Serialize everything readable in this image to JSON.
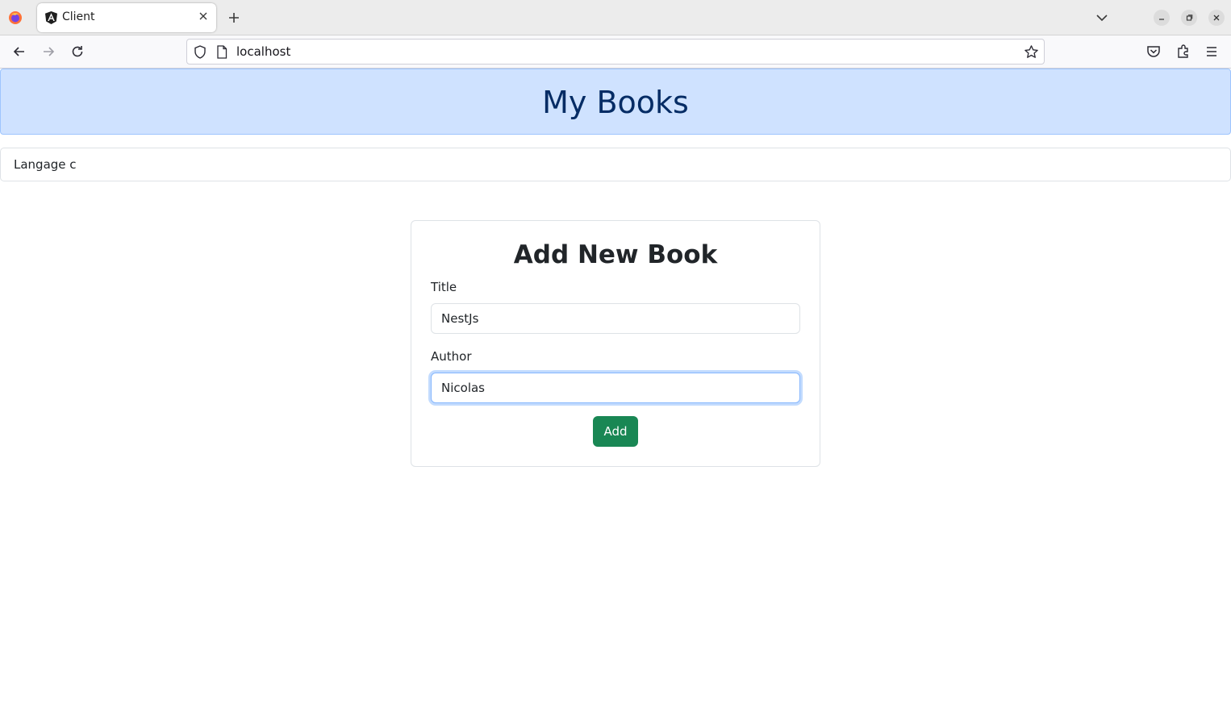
{
  "browser": {
    "tab": {
      "title": "Client"
    },
    "url": "localhost",
    "icons": [
      "firefox-logo-icon",
      "angular-icon",
      "close-icon",
      "plus-icon",
      "chevron-down-icon",
      "minimize-icon",
      "maximize-icon",
      "close-icon",
      "back-arrow-icon",
      "forward-arrow-icon",
      "reload-icon",
      "shield-icon",
      "page-icon",
      "star-icon",
      "pocket-icon",
      "extensions-icon",
      "hamburger-menu-icon"
    ]
  },
  "header": {
    "title": "My Books"
  },
  "books": [
    {
      "title": "Langage c"
    }
  ],
  "form": {
    "heading": "Add New Book",
    "title_label": "Title",
    "title_value": "NestJs",
    "author_label": "Author",
    "author_value": "Nicolas",
    "submit_label": "Add"
  },
  "colors": {
    "header_bg": "#cfe2ff",
    "header_text": "#052c65",
    "button_bg": "#198754"
  }
}
